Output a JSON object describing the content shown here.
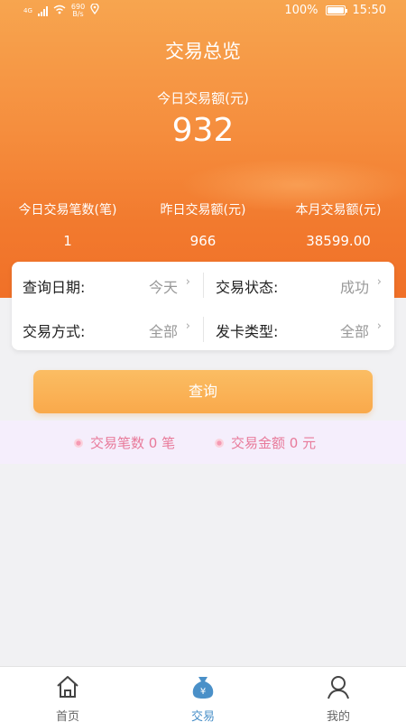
{
  "status_bar": {
    "network": "4G",
    "speed_value": "690",
    "speed_unit": "B/s",
    "battery": "100%",
    "time": "15:50"
  },
  "header": {
    "title": "交易总览",
    "today_amount_label": "今日交易额(元)",
    "today_amount_value": "932"
  },
  "stats": [
    {
      "label": "今日交易笔数(笔)",
      "value": "1"
    },
    {
      "label": "昨日交易额(元)",
      "value": "966"
    },
    {
      "label": "本月交易额(元)",
      "value": "38599.00"
    }
  ],
  "filters": {
    "date": {
      "label": "查询日期:",
      "value": "今天"
    },
    "status": {
      "label": "交易状态:",
      "value": "成功"
    },
    "method": {
      "label": "交易方式:",
      "value": "全部"
    },
    "card_type": {
      "label": "发卡类型:",
      "value": "全部"
    }
  },
  "query_button": "查询",
  "summary": {
    "count_text": "交易笔数 0 笔",
    "amount_text": "交易金额 0 元"
  },
  "tabbar": [
    {
      "label": "首页",
      "icon": "home-icon"
    },
    {
      "label": "交易",
      "icon": "money-bag-icon",
      "active": true
    },
    {
      "label": "我的",
      "icon": "user-icon"
    }
  ],
  "colors": {
    "accent_orange": "#f58d3d",
    "button_orange": "#f9a94b",
    "summary_pink": "#e87a9a",
    "active_tab_blue": "#4a90c8"
  }
}
